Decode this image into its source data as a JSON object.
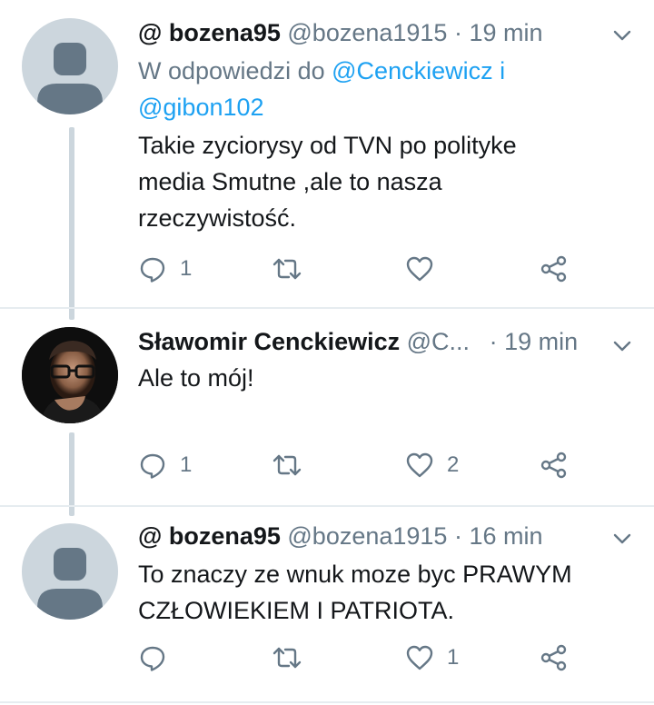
{
  "colors": {
    "text": "#14171a",
    "secondary": "#657786",
    "link": "#1da1f2",
    "line": "#ccd6dd"
  },
  "tweets": [
    {
      "name": "@ bozena95",
      "handle": "@bozena1915",
      "separator": "·",
      "time": "19 min",
      "reply_prefix": "W odpowiedzi do",
      "reply_mention_1": "@Cenckiewicz",
      "reply_conj": "i",
      "reply_mention_2": "@gibon102",
      "text_lines": [
        "Takie zyciorysy od TVN po polityke",
        "media Smutne ,ale to nasza",
        "rzeczywistość."
      ],
      "reply_count": "1",
      "retweet_count": "",
      "like_count": ""
    },
    {
      "name": "Sławomir Cenckiewicz",
      "handle": "@C...",
      "separator": "·",
      "time": "19 min",
      "text_lines": [
        "Ale to mój!"
      ],
      "reply_count": "1",
      "retweet_count": "",
      "like_count": "2"
    },
    {
      "name": "@ bozena95",
      "handle": "@bozena1915",
      "separator": "·",
      "time": "16 min",
      "text_lines": [
        "To znaczy ze wnuk moze byc PRAWYM",
        "CZŁOWIEKIEM I PATRIOTA."
      ],
      "reply_count": "",
      "retweet_count": "",
      "like_count": "1"
    }
  ],
  "icons": [
    "reply-icon",
    "retweet-icon",
    "like-icon",
    "share-icon",
    "chevron-down-icon",
    "default-avatar-icon"
  ]
}
